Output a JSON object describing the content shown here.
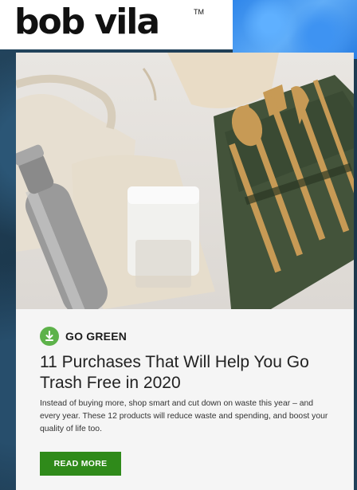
{
  "brand": {
    "logo_text": "bob vila",
    "trademark": "TM"
  },
  "article": {
    "category": "GO GREEN",
    "category_icon": "leaf-download-icon",
    "title": "11 Purchases That Will Help You Go Trash Free in 2020",
    "description": "Instead of buying more, shop smart and cut down on waste this year – and every year. These 12 products will reduce waste and spending, and boost your quality of life too.",
    "cta_label": "READ MORE"
  },
  "colors": {
    "accent_green": "#5db24a",
    "button_green": "#2f8a1a",
    "water_blue": "#3e93f2"
  }
}
